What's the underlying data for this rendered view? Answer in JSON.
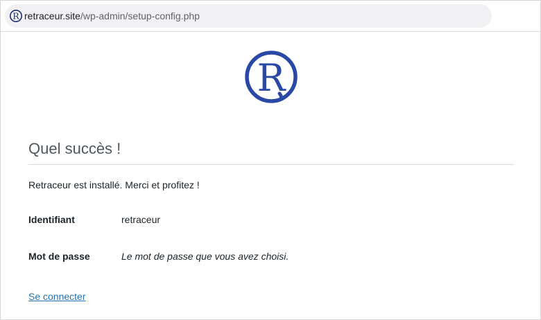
{
  "browser": {
    "url_host": "retraceur.site",
    "url_path": "/wp-admin/setup-config.php",
    "favicon": "retraceur-r-icon"
  },
  "brand": {
    "logo_icon": "retraceur-r-logo",
    "logo_letter": "R",
    "color": "#2a49a6"
  },
  "page": {
    "title": "Quel succès !",
    "message": "Retraceur est installé. Merci et profitez !",
    "details": [
      {
        "label": "Identifiant",
        "value": "retraceur"
      },
      {
        "label": "Mot de passe",
        "value": "Le mot de passe que vous avez choisi."
      }
    ],
    "login_link": "Se connecter"
  }
}
